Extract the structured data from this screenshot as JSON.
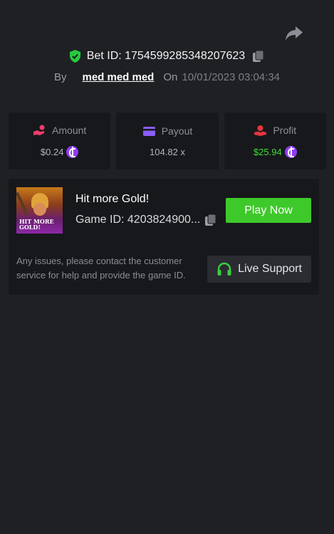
{
  "header": {
    "bet_id_label": "Bet ID: 1754599285348207623",
    "by_label": "By",
    "username": "med med med",
    "on_label": "On",
    "datetime": "10/01/2023 03:04:34"
  },
  "stats": [
    {
      "label": "Amount",
      "value": "$0.24",
      "icon": "hand-coins-icon"
    },
    {
      "label": "Payout",
      "value": "104.82 x",
      "icon": "card-icon"
    },
    {
      "label": "Profit",
      "value": "$25.94",
      "icon": "money-hand-icon"
    }
  ],
  "game": {
    "title": "Hit more Gold!",
    "id_label": "Game ID: 4203824900...",
    "thumb_text_line1": "HIT MORE",
    "thumb_text_line2": "GOLD!",
    "play_label": "Play Now"
  },
  "support": {
    "info": "Any issues, please contact the customer service for help and provide the game ID.",
    "button_label": "Live Support"
  },
  "colors": {
    "background": "#1f2024",
    "card": "#17181b",
    "accent_green": "#3ec92b",
    "profit_green": "#3ddc34",
    "coin_purple": "#8f3cf5"
  }
}
